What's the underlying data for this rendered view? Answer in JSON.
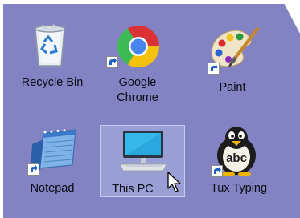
{
  "desktop": {
    "background_color": "#8383c4",
    "icons": [
      {
        "label": "Recycle Bin",
        "icon": "recycle-bin-icon",
        "shortcut": false
      },
      {
        "label": "Google\nChrome",
        "icon": "chrome-icon",
        "shortcut": true
      },
      {
        "label": "Paint",
        "icon": "paint-palette-icon",
        "shortcut": true
      },
      {
        "label": "Notepad",
        "icon": "notepad-icon",
        "shortcut": true
      },
      {
        "label": "This PC",
        "icon": "computer-icon",
        "shortcut": false,
        "selected": true
      },
      {
        "label": "Tux Typing",
        "icon": "penguin-icon",
        "shortcut": true
      }
    ]
  }
}
